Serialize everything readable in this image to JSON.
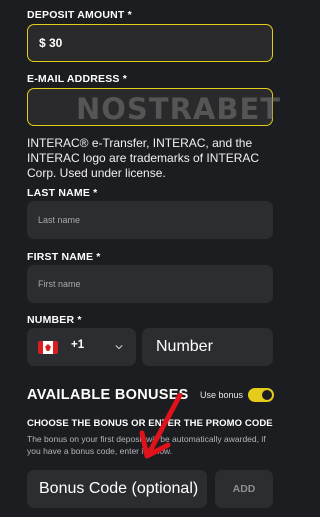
{
  "deposit": {
    "label": "DEPOSIT AMOUNT *",
    "value": "$ 30"
  },
  "email": {
    "label": "E-MAIL ADDRESS *",
    "watermark": "NOSTRABET"
  },
  "notice": "INTERAC® e-Transfer, INTERAC, and the INTERAC logo are trademarks of INTERAC Corp. Used under license.",
  "last_name": {
    "label": "LAST NAME *",
    "placeholder": "Last name"
  },
  "first_name": {
    "label": "FIRST NAME *",
    "placeholder": "First name"
  },
  "number": {
    "label": "NUMBER *",
    "country_code": "+1",
    "placeholder": "Number",
    "flag": "canada-flag-icon"
  },
  "bonuses": {
    "title": "AVAILABLE BONUSES",
    "use_bonus_label": "Use bonus",
    "use_bonus_on": true,
    "promo_title": "CHOOSE THE BONUS OR ENTER THE PROMO CODE",
    "promo_desc": "The bonus on your first deposit will be automatically awarded, if you have a bonus code, enter it below.",
    "code_placeholder": "Bonus Code (optional)",
    "add_label": "ADD"
  },
  "colors": {
    "accent": "#e4cc1a",
    "background": "#1c1d20",
    "field": "#2c2d31",
    "arrow": "#e0121b"
  }
}
